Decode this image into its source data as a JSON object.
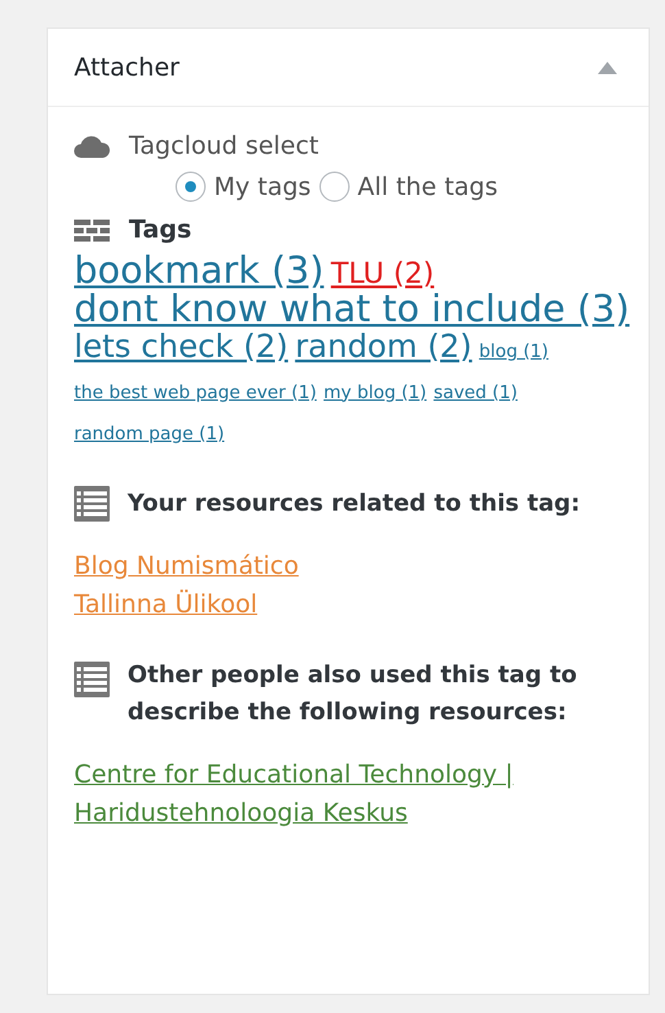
{
  "panel": {
    "title": "Attacher",
    "expanded": true
  },
  "tagcloud_select": {
    "label": "Tagcloud select",
    "options": [
      {
        "label": "My tags",
        "selected": true
      },
      {
        "label": "All the tags",
        "selected": false
      }
    ]
  },
  "tags": {
    "heading": "Tags",
    "items": [
      {
        "label": "bookmark (3)",
        "kind": "xlarge",
        "selected": false
      },
      {
        "label": "TLU (2)",
        "kind": "large",
        "selected": true
      },
      {
        "label": "dont know what to include (3)",
        "kind": "xlarge",
        "selected": false
      },
      {
        "label": "lets check (2)",
        "kind": "large",
        "selected": false
      },
      {
        "label": "random (2)",
        "kind": "large",
        "selected": false
      },
      {
        "label": "blog (1)",
        "kind": "small",
        "selected": false
      },
      {
        "label": "the best web page ever (1)",
        "kind": "small",
        "selected": false
      },
      {
        "label": "my blog (1)",
        "kind": "small",
        "selected": false
      },
      {
        "label": "saved (1)",
        "kind": "small",
        "selected": false
      },
      {
        "label": "random page (1)",
        "kind": "small",
        "selected": false
      }
    ]
  },
  "your_resources": {
    "heading": "Your resources related to this tag:",
    "links": [
      "Blog Numismático",
      "Tallinna Ülikool"
    ]
  },
  "other_resources": {
    "heading": "Other people also used this tag to describe the following resources:",
    "links": [
      "Centre for Educational Technology | Haridustehnoloogia Keskus"
    ]
  }
}
